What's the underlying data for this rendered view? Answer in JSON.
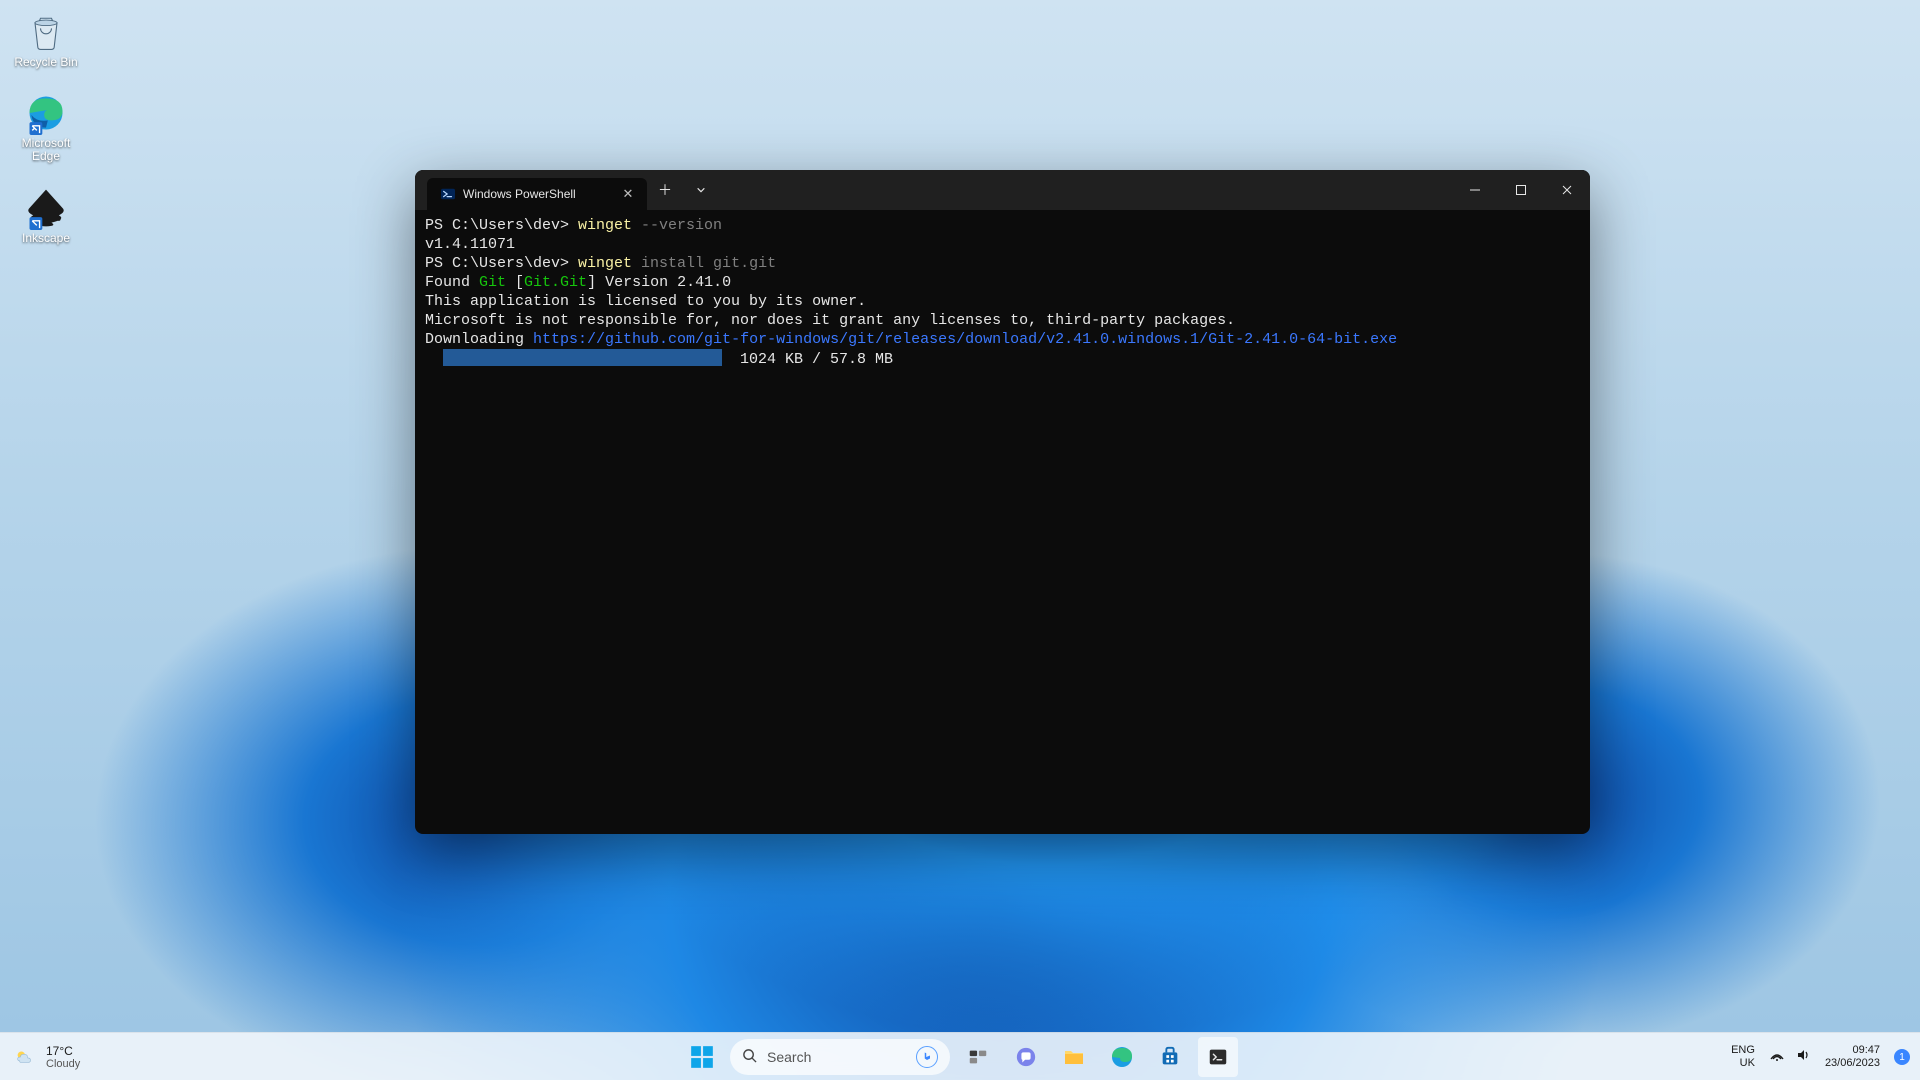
{
  "desktop": {
    "icons": [
      {
        "name": "Recycle Bin"
      },
      {
        "name": "Microsoft Edge"
      },
      {
        "name": "Inkscape"
      }
    ]
  },
  "window": {
    "tab_title": "Windows PowerShell",
    "terminal": {
      "prompt1": "PS C:\\Users\\dev> ",
      "cmd1": "winget",
      "arg1": " --version",
      "line2": "v1.4.11071",
      "prompt2": "PS C:\\Users\\dev> ",
      "cmd2": "winget",
      "arg2a": " install git.git",
      "line4_pre": "Found ",
      "line4_pkg": "Git",
      "line4_mid": " [",
      "line4_id": "Git.Git",
      "line4_post": "] Version 2.41.0",
      "line5": "This application is licensed to you by its owner.",
      "line6": "Microsoft is not responsible for, nor does it grant any licenses to, third-party packages.",
      "line7_pre": "Downloading ",
      "line7_url": "https://github.com/git-for-windows/git/releases/download/v2.41.0.windows.1/Git-2.41.0-64-bit.exe",
      "progress_text": "  1024 KB / 57.8 MB"
    }
  },
  "taskbar": {
    "weather": {
      "temp": "17°C",
      "cond": "Cloudy"
    },
    "search_placeholder": "Search",
    "lang_top": "ENG",
    "lang_bottom": "UK",
    "time": "09:47",
    "date": "23/06/2023",
    "notif_count": "1"
  }
}
